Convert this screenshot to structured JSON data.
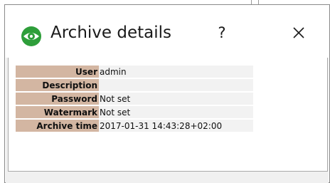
{
  "window": {
    "title": "Archive details",
    "help_label": "?",
    "close_label": "✕",
    "icon": "eye-icon",
    "accent_color": "#2e9e3a"
  },
  "details": {
    "rows": [
      {
        "label": "User",
        "value": "admin"
      },
      {
        "label": "Description",
        "value": ""
      },
      {
        "label": "Password",
        "value": "Not set"
      },
      {
        "label": "Watermark",
        "value": "Not set"
      },
      {
        "label": "Archive time",
        "value": "2017-01-31 14:43:28+02:00"
      }
    ],
    "label_color": "#d3b6a2"
  }
}
